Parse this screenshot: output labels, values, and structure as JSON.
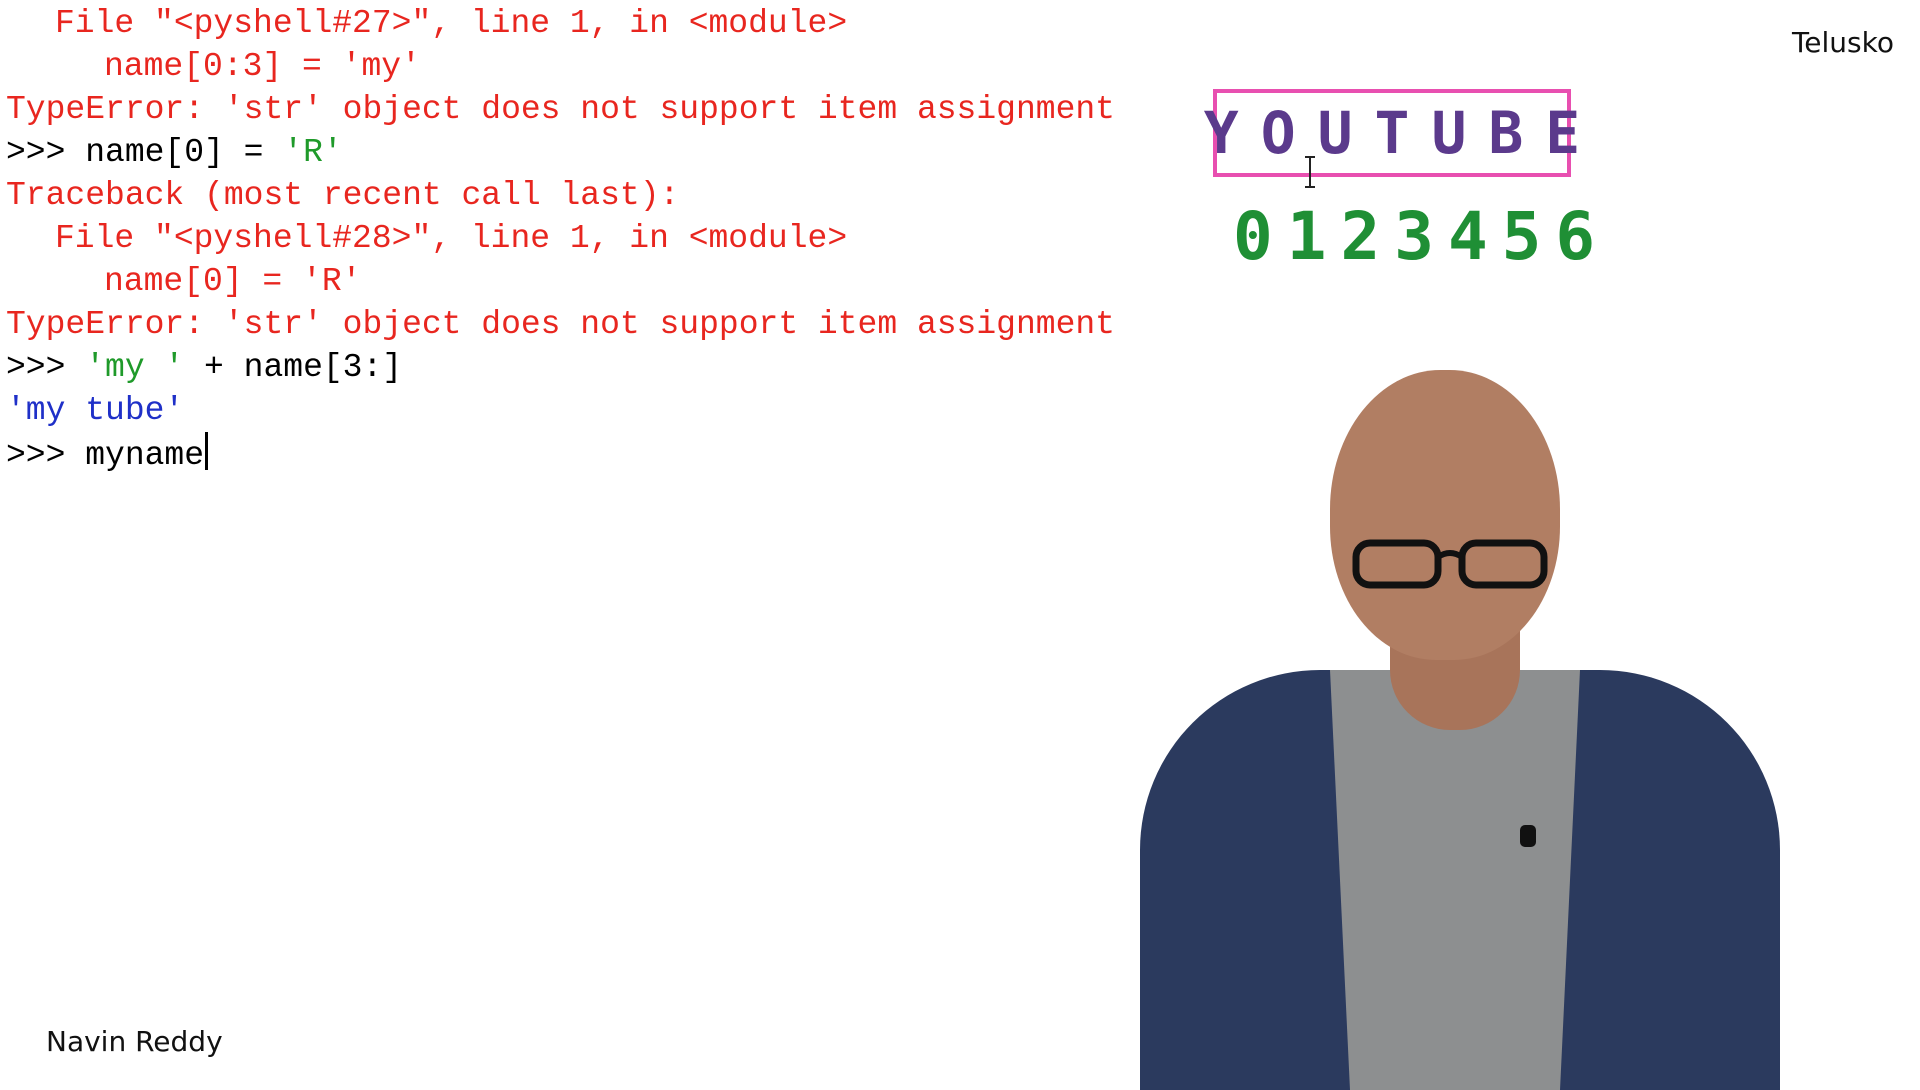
{
  "watermark": "Telusko",
  "caption": "Navin Reddy",
  "overlay": {
    "word": "YOUTUBE",
    "indices": "0123456",
    "word_color": "#5b3a8c",
    "index_color": "#1f8f35",
    "box_color": "#e84fb0"
  },
  "shell": {
    "l1": "File \"<pyshell#27>\", line 1, in <module>",
    "l2": "name[0:3] = 'my'",
    "l3": "TypeError: 'str' object does not support item assignment",
    "l4_prompt": ">>> ",
    "l4_code": "name[0] = ",
    "l4_str": "'R'",
    "l5": "Traceback (most recent call last):",
    "l6": "File \"<pyshell#28>\", line 1, in <module>",
    "l7": "name[0] = 'R'",
    "l8": "TypeError: 'str' object does not support item assignment",
    "l9_prompt": ">>> ",
    "l9_str": "'my '",
    "l9_code": " + name[3:]",
    "l10": "'my tube'",
    "l11_prompt": ">>> ",
    "l11_code": "myname"
  },
  "colors": {
    "error": "#e8261f",
    "string": "#1f9a2a",
    "output": "#1f30c8"
  }
}
